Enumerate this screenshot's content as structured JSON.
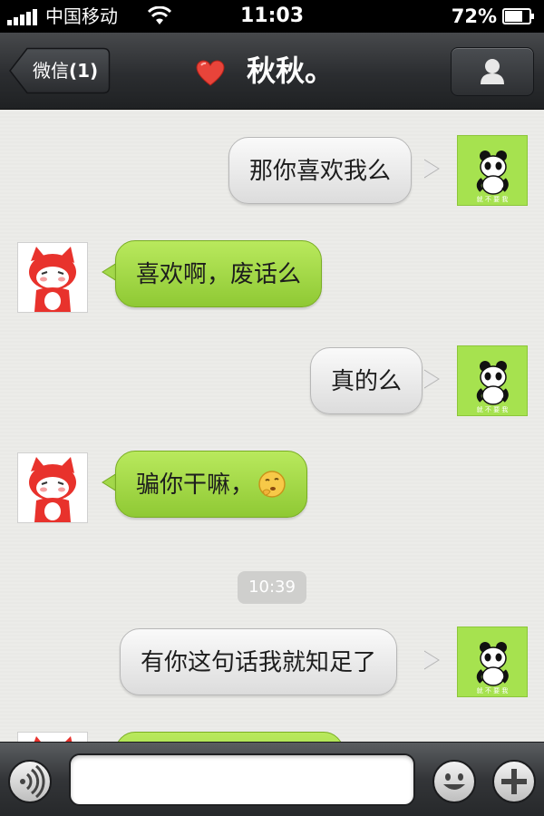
{
  "status_bar": {
    "carrier": "中国移动",
    "time": "11:03",
    "battery_percent": "72%"
  },
  "nav": {
    "back_label": "微信",
    "back_count": "(1)",
    "title": "秋秋。"
  },
  "messages": [
    {
      "direction": "sent",
      "text": "那你喜欢我么"
    },
    {
      "direction": "received",
      "text": "喜欢啊，废话么"
    },
    {
      "direction": "sent",
      "text": "真的么"
    },
    {
      "direction": "received",
      "text": "骗你干嘛，",
      "emoji": "thinking-face-emoji"
    },
    {
      "direction": "sent",
      "text": "有你这句话我就知足了"
    },
    {
      "direction": "received",
      "text": ""
    }
  ],
  "timestamp": "10:39",
  "avatar_caption": "就 不 要 我",
  "input": {
    "value": "",
    "placeholder": ""
  },
  "colors": {
    "incoming_bubble": "#9fd744",
    "outgoing_bubble": "#ebebeb",
    "panda_avatar_bg": "#a6e24f",
    "fox_red": "#e8322c"
  }
}
